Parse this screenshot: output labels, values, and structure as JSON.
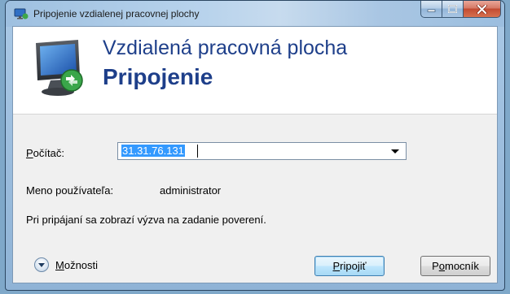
{
  "window": {
    "title": "Pripojenie vzdialenej pracovnej plochy",
    "icons": {
      "app": "remote-desktop-icon",
      "minimize": "minimize-icon",
      "maximize": "maximize-icon",
      "close": "close-icon"
    }
  },
  "banner": {
    "line1": "Vzdialená pracovná plocha",
    "line2": "Pripojenie",
    "icon": "remote-desktop-monitor-icon",
    "accent_color": "#1e3f8a"
  },
  "form": {
    "computer_label_rest": "očítač:",
    "computer_label_mnemonic": "P",
    "computer_value": "31.31.76.131",
    "username_label": "Meno používateľa:",
    "username_value": "administrator",
    "info_text": "Pri pripájaní sa zobrazí výzva na zadanie poverení."
  },
  "footer": {
    "options_mnemonic": "M",
    "options_rest": "ožnosti",
    "connect_mnemonic": "P",
    "connect_rest": "ripojiť",
    "help_mnemonic": "o",
    "help_prefix": "P",
    "help_rest": "mocník"
  }
}
